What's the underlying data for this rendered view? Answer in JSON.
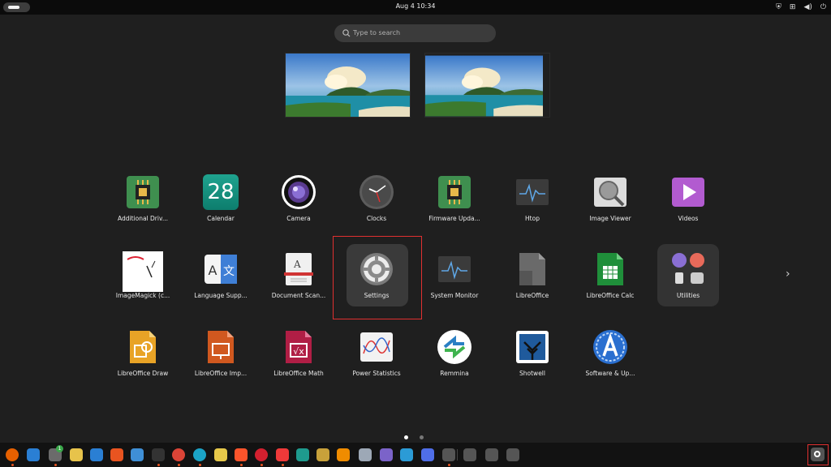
{
  "topbar": {
    "clock": "Aug 4  10:34",
    "tray_icons": [
      "shield-icon",
      "network-icon",
      "volume-icon",
      "power-icon"
    ]
  },
  "search": {
    "placeholder": "Type to search"
  },
  "apps": {
    "row1": [
      "Additional Driv...",
      "Calendar",
      "Camera",
      "Clocks",
      "Firmware Upda...",
      "Htop",
      "Image Viewer",
      "Videos"
    ],
    "row2": [
      "ImageMagick (c...",
      "Language Supp...",
      "Document Scan...",
      "Settings",
      "System Monitor",
      "LibreOffice",
      "LibreOffice Calc",
      "Utilities"
    ],
    "row3": [
      "LibreOffice Draw",
      "LibreOffice Imp...",
      "LibreOffice Math",
      "Power Statistics",
      "Remmina",
      "Shotwell",
      "Software & Up..."
    ]
  },
  "calendar_day": "28",
  "pager": {
    "pages": 2,
    "current": 1,
    "next_glyph": "›"
  },
  "dock": {
    "items": [
      "Firefox",
      "Thunderbird",
      "Files",
      "Rhythmbox",
      "LibreOffice Writer",
      "App Center",
      "Help",
      "Terminal",
      "Chrome",
      "Edge",
      "Text Editor",
      "Brave",
      "Opera",
      "Vivaldi",
      "Xed",
      "Archive",
      "VLC",
      "Disks",
      "Fractal",
      "Remmina",
      "Screenshot",
      "Satellite",
      "USB Drive",
      "Disk",
      "Trash"
    ],
    "badge_count": "1"
  },
  "colors": {
    "highlight": "#e03030",
    "accent": "#e95420"
  }
}
